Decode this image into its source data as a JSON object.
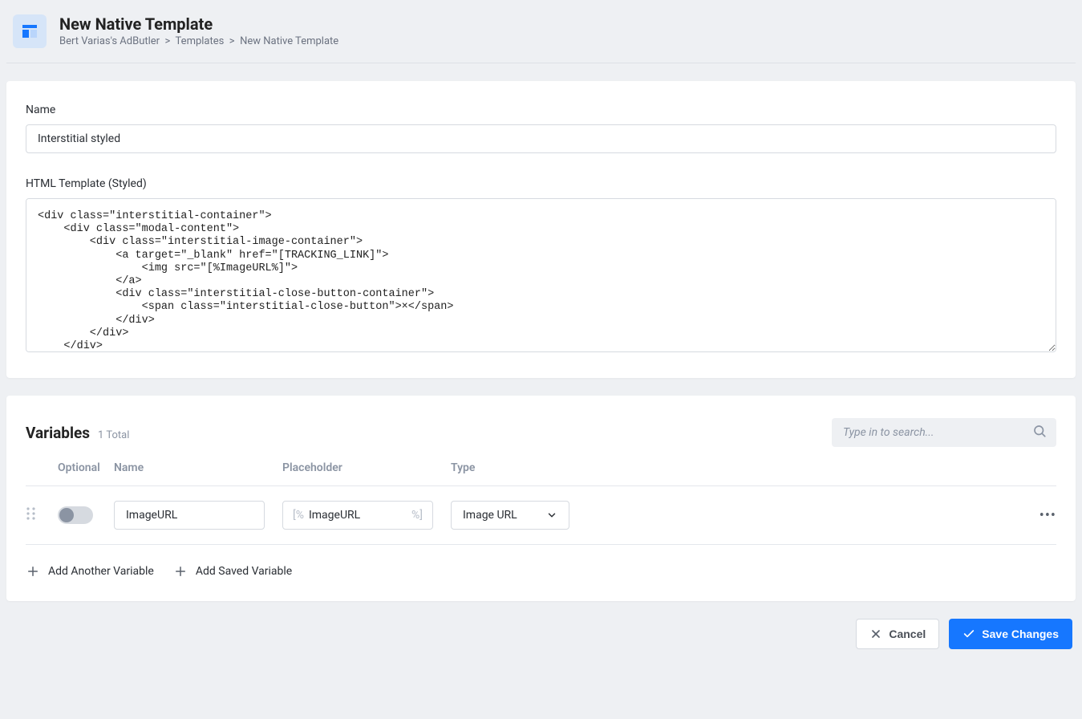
{
  "header": {
    "title": "New Native Template",
    "breadcrumb": {
      "root": "Bert Varias's AdButler",
      "mid": "Templates",
      "current": "New Native Template"
    }
  },
  "form": {
    "name_label": "Name",
    "name_value": "Interstitial styled",
    "html_label": "HTML Template (Styled)",
    "html_value": "<div class=\"interstitial-container\">\n    <div class=\"modal-content\">\n        <div class=\"interstitial-image-container\">\n            <a target=\"_blank\" href=\"[TRACKING_LINK]\">\n                <img src=\"[%ImageURL%]\">\n            </a>\n            <div class=\"interstitial-close-button-container\">\n                <span class=\"interstitial-close-button\">×</span>\n            </div>\n        </div>\n    </div>\n"
  },
  "variables": {
    "title": "Variables",
    "count_label": "1 Total",
    "search_placeholder": "Type in to search...",
    "columns": {
      "optional": "Optional",
      "name": "Name",
      "placeholder": "Placeholder",
      "type": "Type"
    },
    "rows": [
      {
        "name": "ImageURL",
        "placeholder_prefix": "[%",
        "placeholder_value": "ImageURL",
        "placeholder_suffix": "%]",
        "type": "Image URL"
      }
    ],
    "add_another": "Add Another Variable",
    "add_saved": "Add Saved Variable"
  },
  "actions": {
    "cancel": "Cancel",
    "save": "Save Changes"
  }
}
